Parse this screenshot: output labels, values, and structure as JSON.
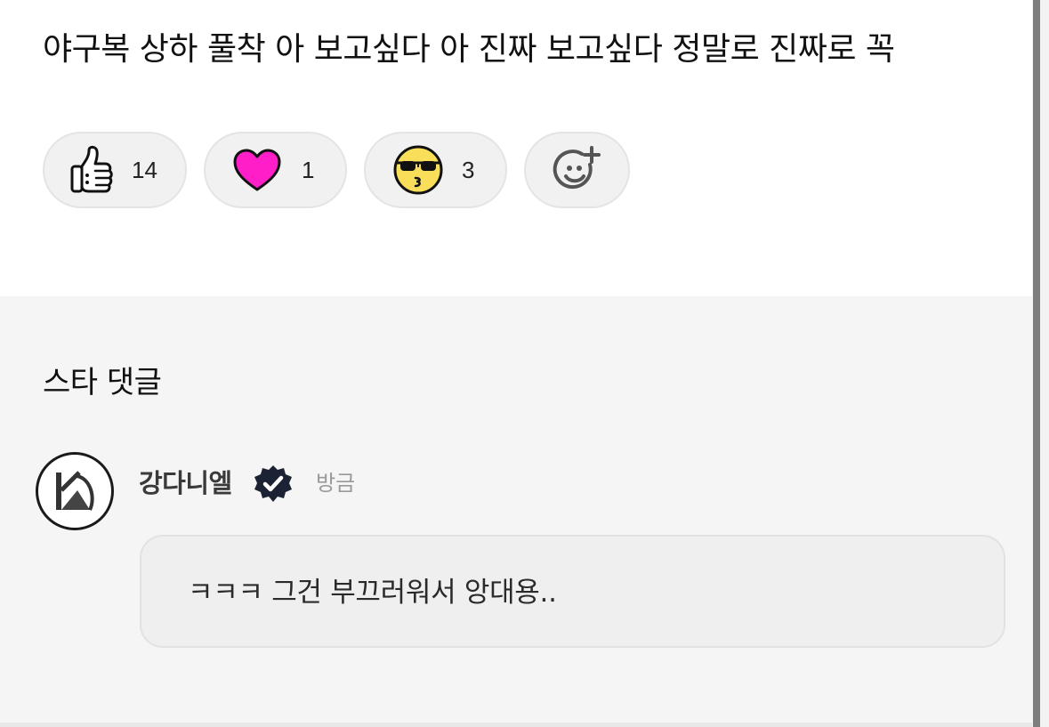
{
  "post": {
    "text": "야구복 상하 풀착 아 보고싶다 아 진짜 보고싶다 정말로 진짜로 꼭"
  },
  "reactions": [
    {
      "icon": "thumbs-up-icon",
      "count": "14"
    },
    {
      "icon": "heart-icon",
      "count": "1",
      "color": "#ff1ec8"
    },
    {
      "icon": "sunglasses-kiss-face-icon",
      "count": "3",
      "color": "#f9de5a"
    },
    {
      "icon": "add-reaction-icon"
    }
  ],
  "comments_section": {
    "title": "스타 댓글",
    "comment": {
      "author": "강다니엘",
      "avatar_icon": "kd-logo-icon",
      "verified_icon": "verified-badge-icon",
      "time": "방금",
      "text": "ㅋㅋㅋ 그건 부끄러워서 앙대용.."
    }
  },
  "colors": {
    "background": "#f5f5f5",
    "card": "#ffffff",
    "pill": "#f1f1f1",
    "verified_badge": "#1b2233"
  }
}
